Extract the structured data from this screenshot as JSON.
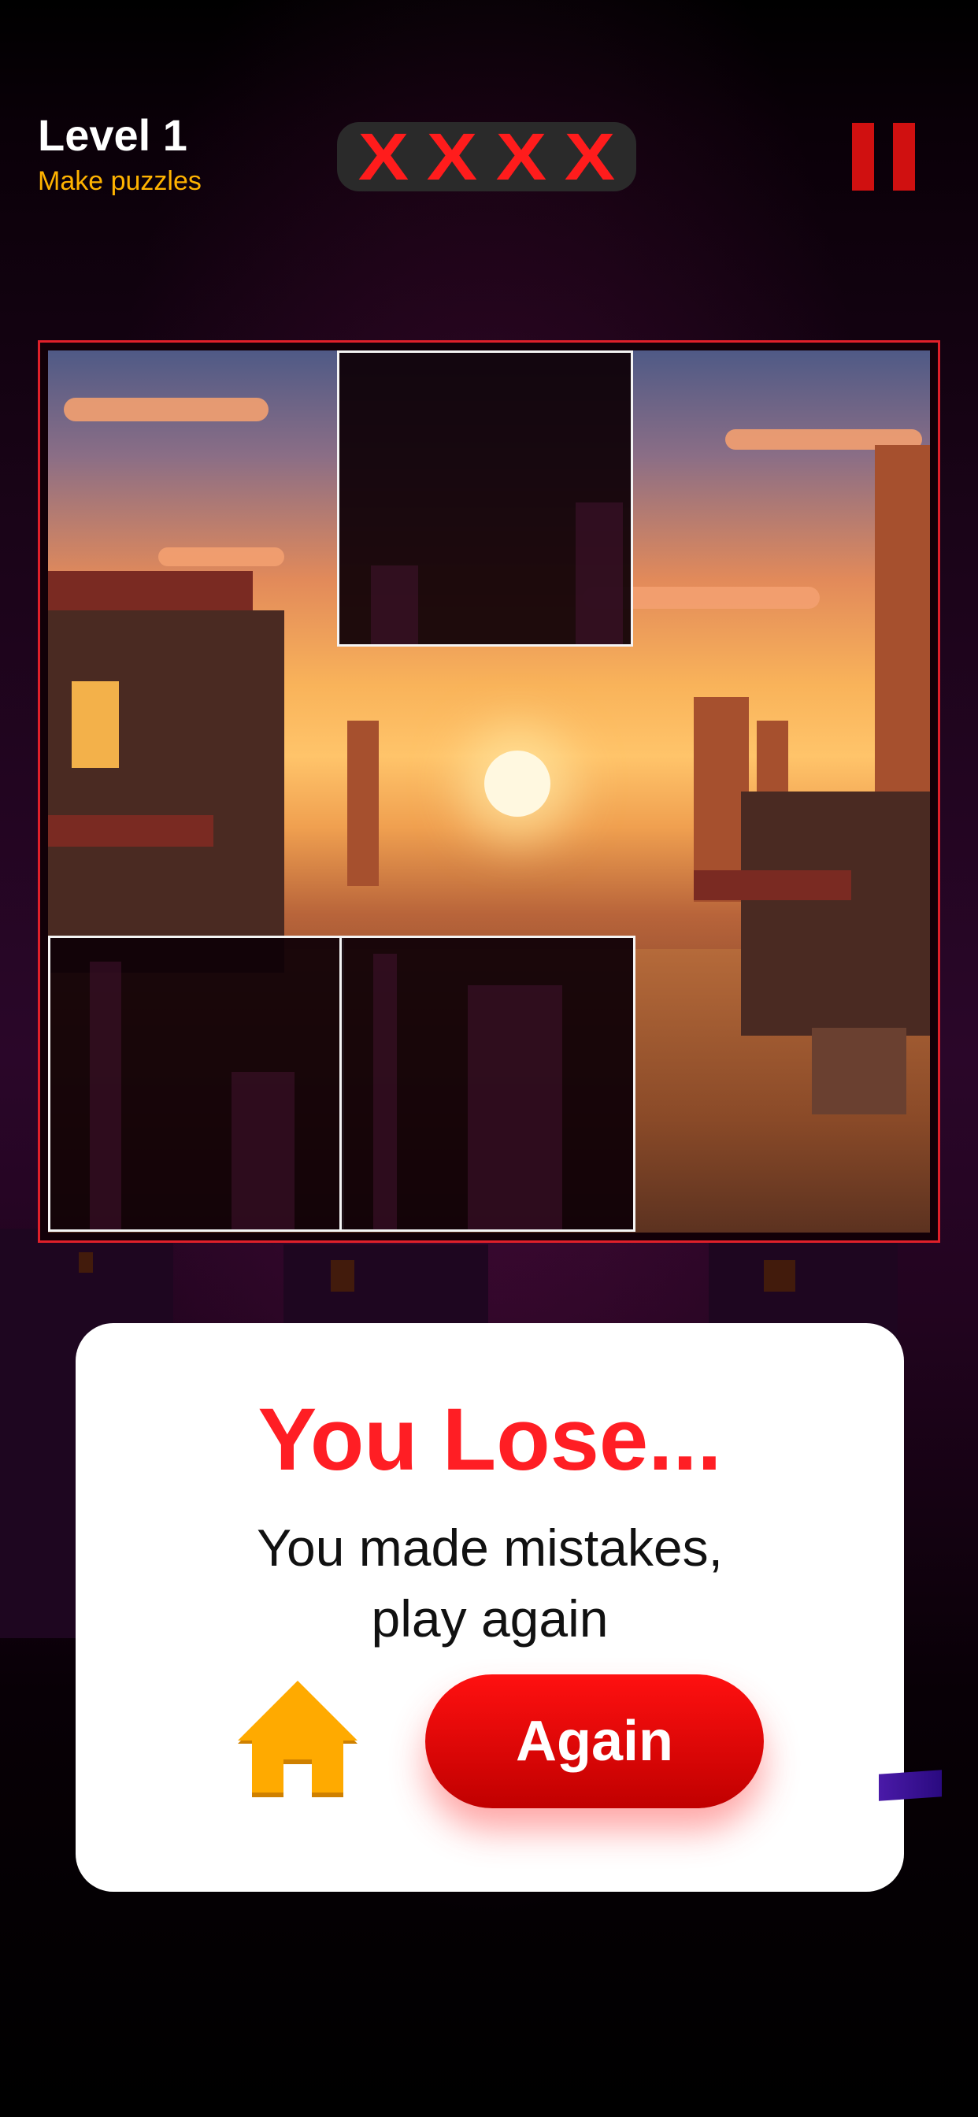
{
  "header": {
    "level_title": "Level 1",
    "level_subtitle": "Make puzzles",
    "mistakes": [
      "X",
      "X",
      "X",
      "X"
    ],
    "mistake_color": "#ff1c1c"
  },
  "dialog": {
    "title": "You Lose...",
    "message_lines": [
      "You made mistakes,",
      "play again"
    ],
    "again_label": "Again",
    "title_color": "#ff1e24",
    "button_color": "#d00000",
    "home_icon_color": "#ffaa00"
  },
  "puzzle": {
    "grid": "3x3",
    "empty_slots": [
      "top-middle",
      "bottom-left",
      "bottom-middle"
    ]
  },
  "colors": {
    "accent_yellow": "#ffb300",
    "board_border": "#e0202a"
  }
}
